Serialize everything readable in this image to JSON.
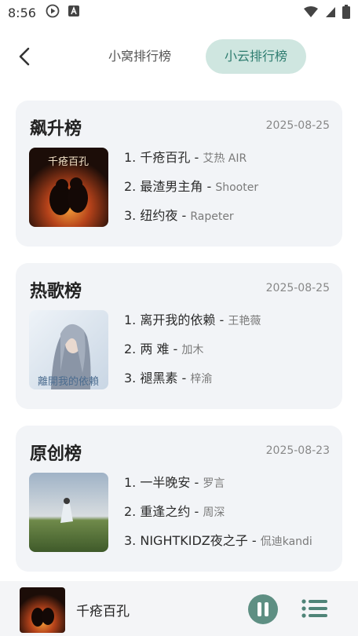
{
  "status_bar": {
    "time": "8:56"
  },
  "header": {
    "tabs": [
      {
        "label": "小窝排行榜",
        "active": false
      },
      {
        "label": "小云排行榜",
        "active": true
      }
    ]
  },
  "charts": [
    {
      "title": "飙升榜",
      "date": "2025-08-25",
      "cover_text": "千疮百孔",
      "tracks": [
        {
          "rank": "1.",
          "song": "千疮百孔",
          "artist": "艾热 AIR"
        },
        {
          "rank": "2.",
          "song": "最渣男主角",
          "artist": "Shooter"
        },
        {
          "rank": "3.",
          "song": "纽约夜",
          "artist": "Rapeter"
        }
      ]
    },
    {
      "title": "热歌榜",
      "date": "2025-08-25",
      "cover_text": "離開我的依賴",
      "tracks": [
        {
          "rank": "1.",
          "song": "离开我的依赖",
          "artist": "王艳薇"
        },
        {
          "rank": "2.",
          "song": "两 难",
          "artist": "加木"
        },
        {
          "rank": "3.",
          "song": "褪黑素",
          "artist": "梓渝"
        }
      ]
    },
    {
      "title": "原创榜",
      "date": "2025-08-23",
      "cover_text": "",
      "tracks": [
        {
          "rank": "1.",
          "song": "一半晚安",
          "artist": "罗言"
        },
        {
          "rank": "2.",
          "song": "重逢之约",
          "artist": "周深"
        },
        {
          "rank": "3.",
          "song": "NIGHTKIDZ夜之子",
          "artist": "侃迪kandi"
        }
      ]
    }
  ],
  "player": {
    "title": "千疮百孔",
    "state": "playing"
  },
  "colors": {
    "accent": "#5e8f83",
    "tab_active_bg": "#cfe6e0",
    "card_bg": "#f2f4f7"
  }
}
